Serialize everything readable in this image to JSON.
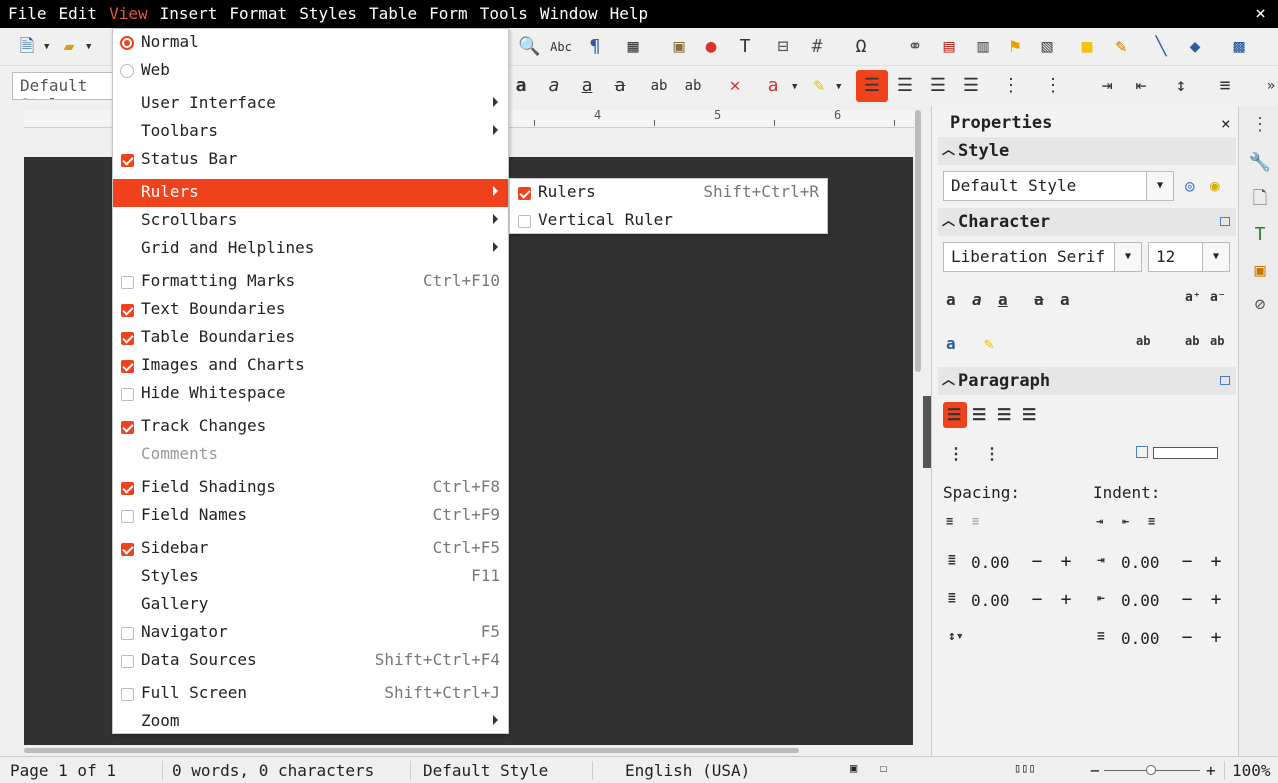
{
  "menubar": {
    "items": [
      "File",
      "Edit",
      "View",
      "Insert",
      "Format",
      "Styles",
      "Table",
      "Form",
      "Tools",
      "Window",
      "Help"
    ],
    "active": "View",
    "close_glyph": "×"
  },
  "toolbar": {
    "paragraph_style": "Default Style"
  },
  "ruler": {
    "marks": [
      "4",
      "5",
      "6"
    ]
  },
  "view_menu": {
    "items": [
      {
        "label": "Normal",
        "kind": "radio",
        "on": true,
        "shortcut": ""
      },
      {
        "label": "Web",
        "kind": "radio",
        "on": false,
        "shortcut": ""
      },
      {
        "label": "User Interface",
        "kind": "sub",
        "shortcut": ""
      },
      {
        "label": "Toolbars",
        "kind": "sub",
        "shortcut": ""
      },
      {
        "label": "Status Bar",
        "kind": "check",
        "on": true,
        "shortcut": ""
      },
      {
        "label": "Rulers",
        "kind": "sub",
        "shortcut": "",
        "highlighted": true
      },
      {
        "label": "Scrollbars",
        "kind": "sub",
        "shortcut": ""
      },
      {
        "label": "Grid and Helplines",
        "kind": "sub",
        "shortcut": ""
      },
      {
        "label": "Formatting Marks",
        "kind": "check",
        "on": false,
        "shortcut": "Ctrl+F10"
      },
      {
        "label": "Text Boundaries",
        "kind": "check",
        "on": true,
        "shortcut": ""
      },
      {
        "label": "Table Boundaries",
        "kind": "check",
        "on": true,
        "shortcut": ""
      },
      {
        "label": "Images and Charts",
        "kind": "check",
        "on": true,
        "shortcut": ""
      },
      {
        "label": "Hide Whitespace",
        "kind": "check",
        "on": false,
        "shortcut": ""
      },
      {
        "label": "Track Changes",
        "kind": "check",
        "on": true,
        "shortcut": ""
      },
      {
        "label": "Comments",
        "kind": "plain",
        "disabled": true,
        "shortcut": ""
      },
      {
        "label": "Field Shadings",
        "kind": "check",
        "on": true,
        "shortcut": "Ctrl+F8"
      },
      {
        "label": "Field Names",
        "kind": "check",
        "on": false,
        "shortcut": "Ctrl+F9"
      },
      {
        "label": "Sidebar",
        "kind": "check",
        "on": true,
        "shortcut": "Ctrl+F5"
      },
      {
        "label": "Styles",
        "kind": "plain",
        "shortcut": "F11"
      },
      {
        "label": "Gallery",
        "kind": "plain",
        "shortcut": ""
      },
      {
        "label": "Navigator",
        "kind": "check",
        "on": false,
        "shortcut": "F5"
      },
      {
        "label": "Data Sources",
        "kind": "check",
        "on": false,
        "shortcut": "Shift+Ctrl+F4"
      },
      {
        "label": "Full Screen",
        "kind": "check",
        "on": false,
        "shortcut": "Shift+Ctrl+J"
      },
      {
        "label": "Zoom",
        "kind": "sub",
        "shortcut": ""
      }
    ]
  },
  "rulers_submenu": {
    "items": [
      {
        "label": "Rulers",
        "on": true,
        "shortcut": "Shift+Ctrl+R"
      },
      {
        "label": "Vertical Ruler",
        "on": false,
        "shortcut": ""
      }
    ]
  },
  "sidebar": {
    "title": "Properties",
    "close_glyph": "×",
    "style_section": "Style",
    "style_value": "Default Style",
    "character_section": "Character",
    "font_name": "Liberation Serif",
    "font_size": "12",
    "paragraph_section": "Paragraph",
    "spacing_label": "Spacing:",
    "indent_label": "Indent:",
    "spacing_values": [
      "0.00",
      "0.00"
    ],
    "indent_values": [
      "0.00",
      "0.00",
      "0.00"
    ],
    "minus": "−",
    "plus": "+"
  },
  "statusbar": {
    "page": "Page 1 of 1",
    "words": "0 words, 0 characters",
    "style": "Default Style",
    "language": "English (USA)",
    "zoom": "100%"
  },
  "colors": {
    "accent": "#f0431d",
    "menubar_bg": "#000000",
    "document_bg": "#323232"
  }
}
